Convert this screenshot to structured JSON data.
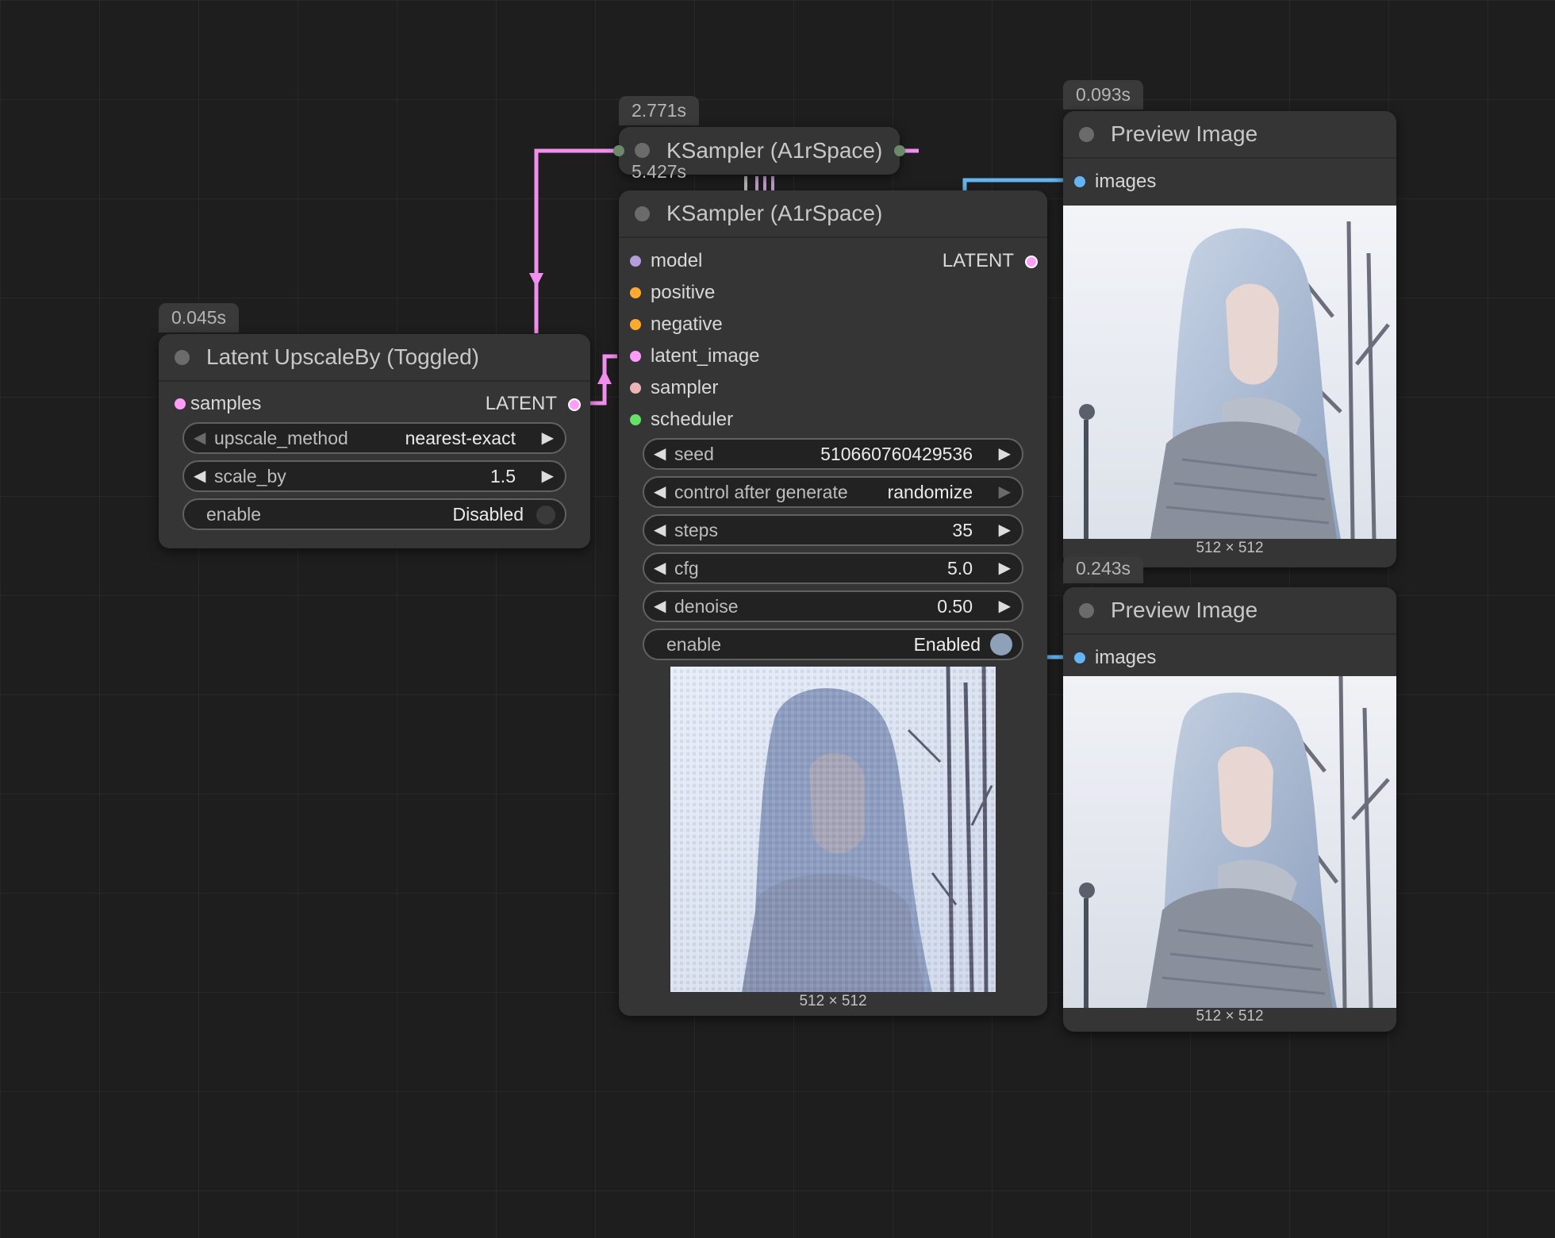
{
  "colors": {
    "canvas_bg": "#1e1e1e",
    "node_bg": "#353535",
    "latent_link": "#f28ef0",
    "image_link": "#64b4f0",
    "model_pin": "#b39ddb",
    "conditioning_pin": "#ffa931",
    "latent_pin": "#ff9cf9",
    "sampler_pin": "#ecb4b4",
    "scheduler_pin": "#66e066",
    "images_pin": "#64b5f6",
    "toggle_on": "#8da2b8",
    "toggle_off": "#3a3a3a"
  },
  "nodes": {
    "latent_upscale": {
      "timing": "0.045s",
      "title": "Latent UpscaleBy (Toggled)",
      "input_samples": "samples",
      "output_latent": "LATENT",
      "upscale_method": {
        "label": "upscale_method",
        "value": "nearest-exact"
      },
      "scale_by": {
        "label": "scale_by",
        "value": "1.5"
      },
      "enable": {
        "label": "enable",
        "value": "Disabled"
      }
    },
    "ksampler_collapsed": {
      "timing": "2.771s",
      "title": "KSampler (A1rSpace)"
    },
    "ksampler": {
      "timing": "5.427s",
      "title": "KSampler (A1rSpace)",
      "inputs": [
        "model",
        "positive",
        "negative",
        "latent_image",
        "sampler",
        "scheduler"
      ],
      "output_latent": "LATENT",
      "seed": {
        "label": "seed",
        "value": "510660760429536"
      },
      "control_after_generate": {
        "label": "control after generate",
        "value": "randomize"
      },
      "steps": {
        "label": "steps",
        "value": "35"
      },
      "cfg": {
        "label": "cfg",
        "value": "5.0"
      },
      "denoise": {
        "label": "denoise",
        "value": "0.50"
      },
      "enable": {
        "label": "enable",
        "value": "Enabled"
      },
      "preview_dims": "512 × 512"
    },
    "preview_top": {
      "timing": "0.093s",
      "title": "Preview Image",
      "input_images": "images",
      "dims": "512 × 512"
    },
    "preview_bottom": {
      "timing": "0.243s",
      "title": "Preview Image",
      "input_images": "images",
      "dims": "512 × 512"
    }
  }
}
